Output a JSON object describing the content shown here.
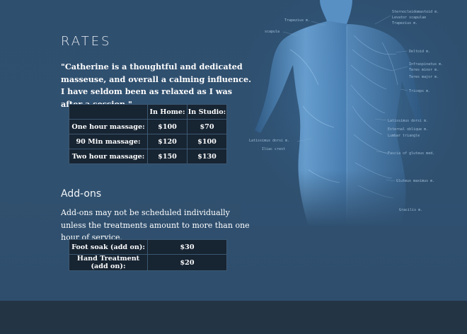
{
  "rates_title": "RATES",
  "quote": "\"Catherine is a thoughtful and dedicated masseuse, and overall a calming influence. I have seldom been as relaxed as I was after a session.\"",
  "rates_table": {
    "headers": [
      "",
      "In Home:",
      "In Studio:"
    ],
    "rows": [
      {
        "label": "One hour massage:",
        "in_home": "$100",
        "in_studio": "$70"
      },
      {
        "label": "90 Min massage:",
        "in_home": "$120",
        "in_studio": "$100"
      },
      {
        "label": "Two hour massage:",
        "in_home": "$150",
        "in_studio": "$130"
      }
    ]
  },
  "addons": {
    "heading": "Add-ons",
    "text": "Add-ons may not be scheduled individually unless the treatments amount to more than one hour of service.",
    "rows": [
      {
        "label": "Foot soak (add on):",
        "price": "$30"
      },
      {
        "label": "Hand Treatment (add on):",
        "price": "$20"
      }
    ]
  },
  "anatomy_labels": {
    "trapezius": "Trapezius m.",
    "sterno": "Sternocleidomastoid m.",
    "levator": "Levator scapulae",
    "trapezius2": "Trapezius m.",
    "scapula": "scapula",
    "deltoid": "Deltoid m.",
    "infraspinatus": "Infraspinatus m.",
    "teres_minor": "Teres minor m.",
    "teres_major": "Teres major m.",
    "triceps": "Triceps m.",
    "latissimus": "Latissimus dorsi m.",
    "ext_oblique": "External oblique m.",
    "lumbar": "Lumbar triangle",
    "fascia": "Fascia of gluteus med.",
    "lat_dorsi_left": "Latissimus dorsi m.",
    "iliac": "Iliac crest",
    "gluteus": "Gluteus maximus m.",
    "gracilis": "Gracilis m."
  },
  "colors": {
    "background": "#2f5070",
    "footer": "#233445",
    "table_bg": "#172432",
    "table_border": "#3c5872"
  }
}
